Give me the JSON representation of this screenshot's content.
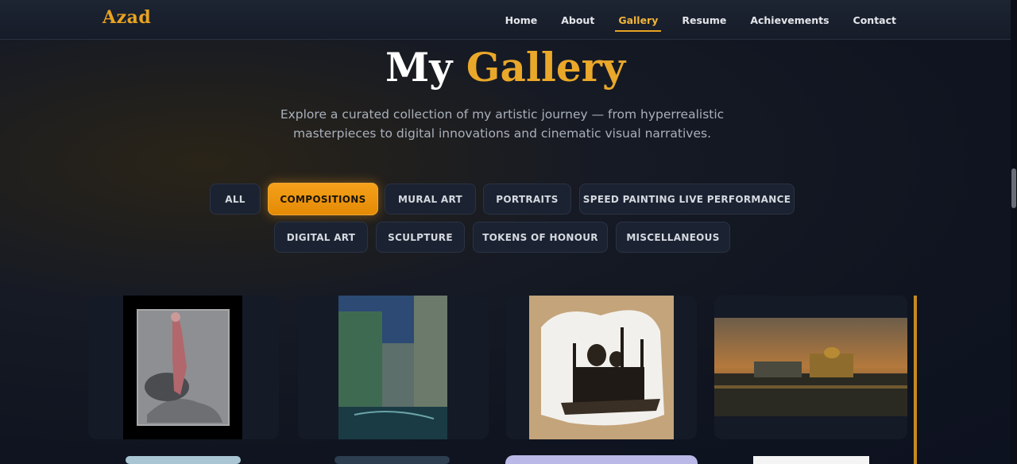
{
  "header": {
    "logo": "Azad",
    "nav": [
      "Home",
      "About",
      "Gallery",
      "Resume",
      "Achievements",
      "Contact"
    ],
    "active": "Gallery"
  },
  "hero": {
    "title_plain": "My",
    "title_accent": "Gallery",
    "subtitle_line1": "Explore a curated collection of my artistic journey — from hyperrealistic",
    "subtitle_line2": "masterpieces to digital innovations and cinematic visual narratives."
  },
  "filters": {
    "row1": [
      "ALL",
      "COMPOSITIONS",
      "MURAL ART",
      "PORTRAITS",
      "SPEED PAINTING LIVE PERFORMANCE"
    ],
    "row2": [
      "DIGITAL ART",
      "SCULPTURE",
      "TOKENS OF HONOUR",
      "MISCELLANEOUS"
    ],
    "active": "COMPOSITIONS"
  },
  "colors": {
    "accent": "#e8a321",
    "background": "#0f1420",
    "card": "#141a26"
  },
  "gallery": {
    "items": [
      "figure-sketch-artwork",
      "venice-canal-painting",
      "mosque-sketch-artwork",
      "golden-temple-painting"
    ]
  }
}
